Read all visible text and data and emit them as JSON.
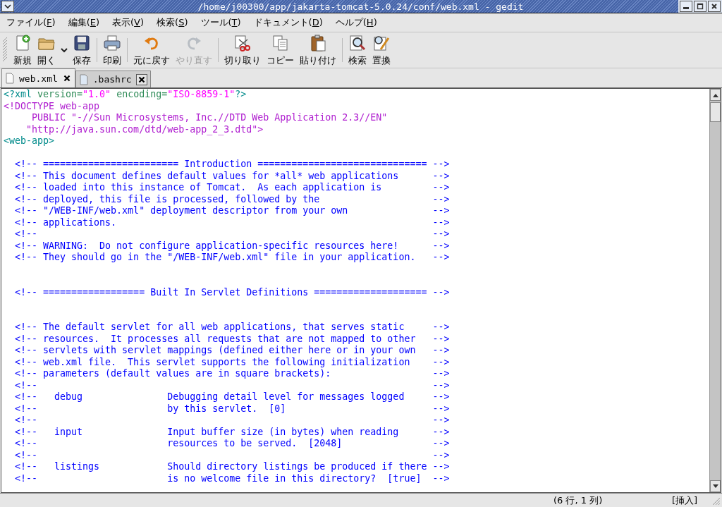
{
  "window": {
    "title": "/home/j00300/app/jakarta-tomcat-5.0.24/conf/web.xml - gedit"
  },
  "menu": [
    {
      "before": "ファイル(",
      "key": "F",
      "after": ")"
    },
    {
      "before": "編集(",
      "key": "E",
      "after": ")"
    },
    {
      "before": "表示(",
      "key": "V",
      "after": ")"
    },
    {
      "before": "検索(",
      "key": "S",
      "after": ")"
    },
    {
      "before": "ツール(",
      "key": "T",
      "after": ")"
    },
    {
      "before": "ドキュメント(",
      "key": "D",
      "after": ")"
    },
    {
      "before": "ヘルプ(",
      "key": "H",
      "after": ")"
    }
  ],
  "toolbar": [
    {
      "kind": "button",
      "label": "新規",
      "disabled": false
    },
    {
      "kind": "button",
      "label": "開く",
      "disabled": false
    },
    {
      "kind": "dropdown"
    },
    {
      "kind": "button",
      "label": "保存",
      "disabled": false
    },
    {
      "kind": "separator"
    },
    {
      "kind": "button",
      "label": "印刷",
      "disabled": false
    },
    {
      "kind": "separator"
    },
    {
      "kind": "button",
      "label": "元に戻す",
      "disabled": false
    },
    {
      "kind": "button",
      "label": "やり直す",
      "disabled": true
    },
    {
      "kind": "separator"
    },
    {
      "kind": "button",
      "label": "切り取り",
      "disabled": false
    },
    {
      "kind": "button",
      "label": "コピー",
      "disabled": false
    },
    {
      "kind": "button",
      "label": "貼り付け",
      "disabled": false
    },
    {
      "kind": "separator"
    },
    {
      "kind": "button",
      "label": "検索",
      "disabled": false
    },
    {
      "kind": "button",
      "label": "置換",
      "disabled": false
    }
  ],
  "tabs": [
    {
      "label": "web.xml",
      "selected": true
    },
    {
      "label": ".bashrc",
      "selected": false
    }
  ],
  "editor": {
    "lines": [
      {
        "kind": "code",
        "segments": [
          {
            "kind": "tag",
            "text": "<?xml "
          },
          {
            "kind": "attr",
            "text": "version="
          },
          {
            "kind": "value",
            "text": "\"1.0\""
          },
          {
            "kind": "attr",
            "text": " encoding="
          },
          {
            "kind": "value",
            "text": "\"ISO-8859-1\""
          },
          {
            "kind": "tag",
            "text": "?>"
          }
        ]
      },
      {
        "kind": "code",
        "segments": [
          {
            "kind": "doctype",
            "text": "<!DOCTYPE web-app"
          }
        ]
      },
      {
        "kind": "code",
        "segments": [
          {
            "kind": "doctype",
            "text": "     PUBLIC \"-//Sun Microsystems, Inc.//DTD Web Application 2.3//EN\""
          }
        ]
      },
      {
        "kind": "code",
        "segments": [
          {
            "kind": "doctype",
            "text": "    \"http://java.sun.com/dtd/web-app_2_3.dtd\">"
          }
        ]
      },
      {
        "kind": "code",
        "segments": [
          {
            "kind": "tag",
            "text": "<web-app>"
          }
        ]
      },
      {
        "kind": "blank"
      },
      {
        "kind": "code",
        "segments": [
          {
            "kind": "comment",
            "text": "  <!-- ======================== Introduction =============================="
          }
        ],
        "end": "-->"
      },
      {
        "kind": "code",
        "segments": [
          {
            "kind": "comment",
            "text": "  <!-- This document defines default values for *all* web applications"
          }
        ],
        "end": "-->"
      },
      {
        "kind": "code",
        "segments": [
          {
            "kind": "comment",
            "text": "  <!-- loaded into this instance of Tomcat.  As each application is"
          }
        ],
        "end": "-->"
      },
      {
        "kind": "code",
        "segments": [
          {
            "kind": "comment",
            "text": "  <!-- deployed, this file is processed, followed by the"
          }
        ],
        "end": "-->"
      },
      {
        "kind": "code",
        "segments": [
          {
            "kind": "comment",
            "text": "  <!-- \"/WEB-INF/web.xml\" deployment descriptor from your own"
          }
        ],
        "end": "-->"
      },
      {
        "kind": "code",
        "segments": [
          {
            "kind": "comment",
            "text": "  <!-- applications."
          }
        ],
        "end": "-->"
      },
      {
        "kind": "code",
        "segments": [
          {
            "kind": "comment",
            "text": "  <!--"
          }
        ],
        "end": "-->"
      },
      {
        "kind": "code",
        "segments": [
          {
            "kind": "comment",
            "text": "  <!-- WARNING:  Do not configure application-specific resources here!"
          }
        ],
        "end": "-->"
      },
      {
        "kind": "code",
        "segments": [
          {
            "kind": "comment",
            "text": "  <!-- They should go in the \"/WEB-INF/web.xml\" file in your application."
          }
        ],
        "end": "-->"
      },
      {
        "kind": "blank"
      },
      {
        "kind": "blank"
      },
      {
        "kind": "code",
        "segments": [
          {
            "kind": "comment",
            "text": "  <!-- ================== Built In Servlet Definitions ===================="
          }
        ],
        "end": "-->"
      },
      {
        "kind": "blank"
      },
      {
        "kind": "blank"
      },
      {
        "kind": "code",
        "segments": [
          {
            "kind": "comment",
            "text": "  <!-- The default servlet for all web applications, that serves static"
          }
        ],
        "end": "-->"
      },
      {
        "kind": "code",
        "segments": [
          {
            "kind": "comment",
            "text": "  <!-- resources.  It processes all requests that are not mapped to other"
          }
        ],
        "end": "-->"
      },
      {
        "kind": "code",
        "segments": [
          {
            "kind": "comment",
            "text": "  <!-- servlets with servlet mappings (defined either here or in your own"
          }
        ],
        "end": "-->"
      },
      {
        "kind": "code",
        "segments": [
          {
            "kind": "comment",
            "text": "  <!-- web.xml file.  This servlet supports the following initialization"
          }
        ],
        "end": "-->"
      },
      {
        "kind": "code",
        "segments": [
          {
            "kind": "comment",
            "text": "  <!-- parameters (default values are in square brackets):"
          }
        ],
        "end": "-->"
      },
      {
        "kind": "code",
        "segments": [
          {
            "kind": "comment",
            "text": "  <!--"
          }
        ],
        "end": "-->"
      },
      {
        "kind": "code",
        "segments": [
          {
            "kind": "comment",
            "text": "  <!--   debug               Debugging detail level for messages logged"
          }
        ],
        "end": "-->"
      },
      {
        "kind": "code",
        "segments": [
          {
            "kind": "comment",
            "text": "  <!--                       by this servlet.  [0]"
          }
        ],
        "end": "-->"
      },
      {
        "kind": "code",
        "segments": [
          {
            "kind": "comment",
            "text": "  <!--"
          }
        ],
        "end": "-->"
      },
      {
        "kind": "code",
        "segments": [
          {
            "kind": "comment",
            "text": "  <!--   input               Input buffer size (in bytes) when reading"
          }
        ],
        "end": "-->"
      },
      {
        "kind": "code",
        "segments": [
          {
            "kind": "comment",
            "text": "  <!--                       resources to be served.  [2048]"
          }
        ],
        "end": "-->"
      },
      {
        "kind": "code",
        "segments": [
          {
            "kind": "comment",
            "text": "  <!--"
          }
        ],
        "end": "-->"
      },
      {
        "kind": "code",
        "segments": [
          {
            "kind": "comment",
            "text": "  <!--   listings            Should directory listings be produced if there"
          }
        ],
        "end": "-->"
      },
      {
        "kind": "code",
        "segments": [
          {
            "kind": "comment",
            "text": "  <!--                       is no welcome file in this directory?  [true]"
          }
        ],
        "end": "-->"
      }
    ]
  },
  "status_bar": {
    "position": "(6 行, 1 列)",
    "mode": "[挿入]"
  }
}
